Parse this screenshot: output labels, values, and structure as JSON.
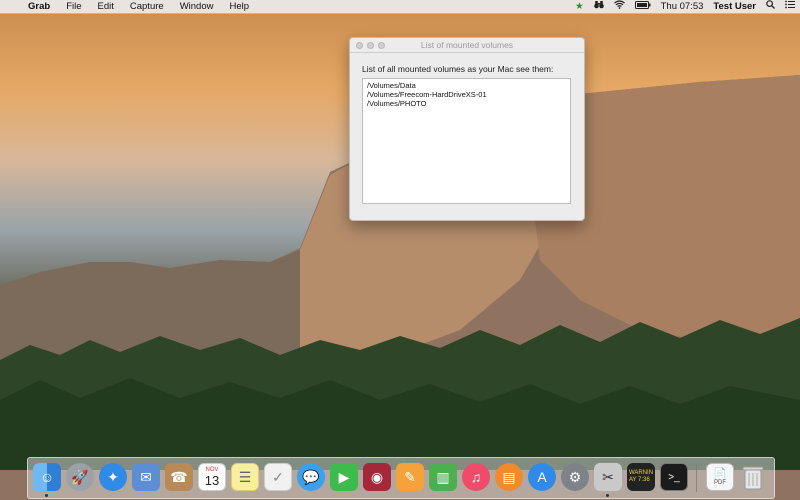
{
  "menubar": {
    "app_name": "Grab",
    "menus": [
      "File",
      "Edit",
      "Capture",
      "Window",
      "Help"
    ],
    "clock": "Thu 07:53",
    "user": "Test User"
  },
  "window": {
    "title": "List of mounted volumes",
    "label": "List of all mounted volumes as your Mac see them:",
    "volumes": [
      "/Volumes/Data",
      "/Volumes/Freecom-HardDriveXS-01",
      "/Volumes/PHOTO"
    ]
  },
  "dock": {
    "calendar_month": "NOV",
    "calendar_day": "13",
    "console_text": "WARNIN\nAY 7:36",
    "pdf_label": "PDF",
    "icons": [
      "finder-icon",
      "launchpad-icon",
      "safari-icon",
      "mail-icon",
      "contacts-icon",
      "calendar-icon",
      "notes-icon",
      "reminders-icon",
      "messages-icon",
      "facetime-icon",
      "photo-booth-icon",
      "pages-icon",
      "numbers-icon",
      "itunes-icon",
      "ibooks-icon",
      "app-store-icon",
      "system-preferences-icon",
      "grab-icon",
      "console-icon",
      "terminal-icon",
      "pdf-document-icon",
      "trash-icon"
    ]
  }
}
